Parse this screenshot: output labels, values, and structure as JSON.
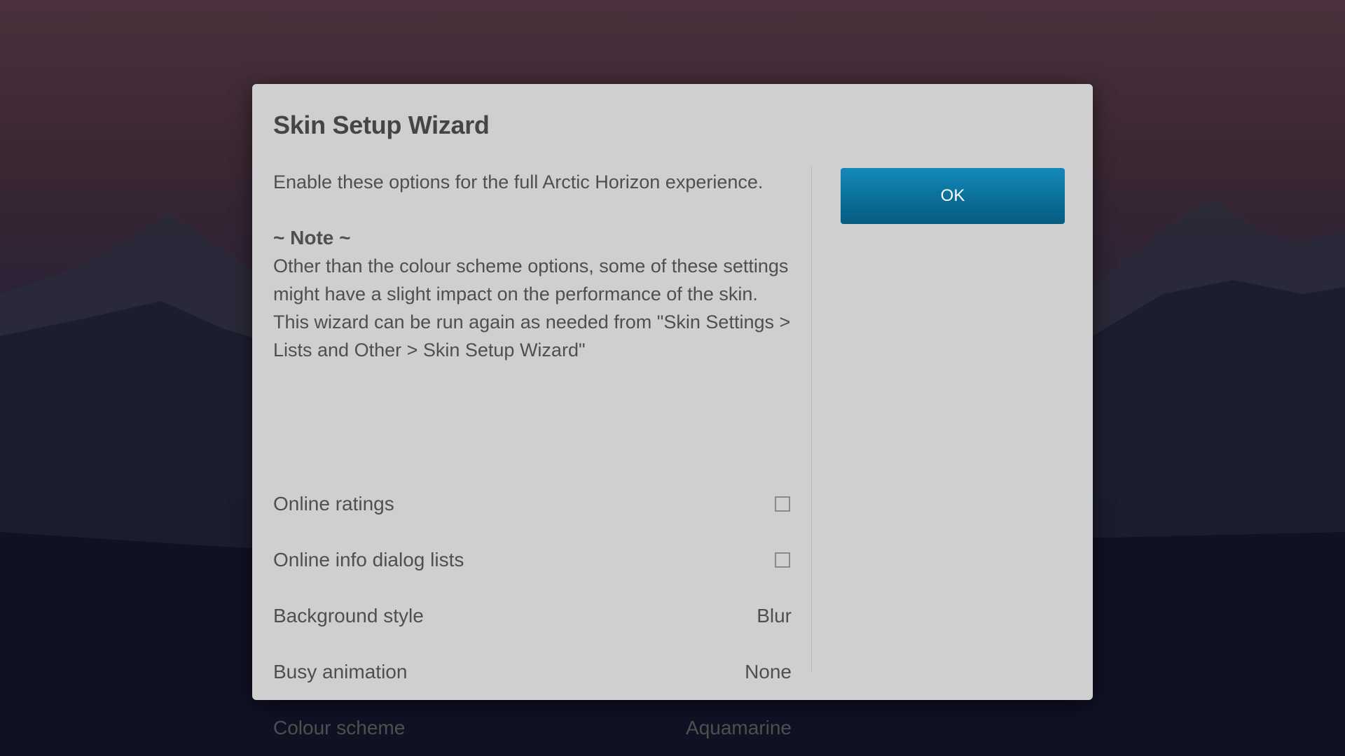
{
  "dialog": {
    "title": "Skin Setup Wizard",
    "intro": "Enable these options for the full Arctic Horizon experience.",
    "note_heading": "~ Note ~",
    "note_body": "Other than the colour scheme options, some of these settings might have a slight impact on the performance of the skin. This wizard can be run again as needed from \"Skin Settings > Lists and Other > Skin Setup Wizard\"",
    "ok_label": "OK",
    "accent_color": "#0a7aa8"
  },
  "settings": [
    {
      "label": "Online ratings",
      "type": "checkbox",
      "checked": false
    },
    {
      "label": "Online info dialog lists",
      "type": "checkbox",
      "checked": false
    },
    {
      "label": "Background style",
      "type": "value",
      "value": "Blur"
    },
    {
      "label": "Busy animation",
      "type": "value",
      "value": "None"
    },
    {
      "label": "Colour scheme",
      "type": "value",
      "value": "Aquamarine"
    }
  ]
}
